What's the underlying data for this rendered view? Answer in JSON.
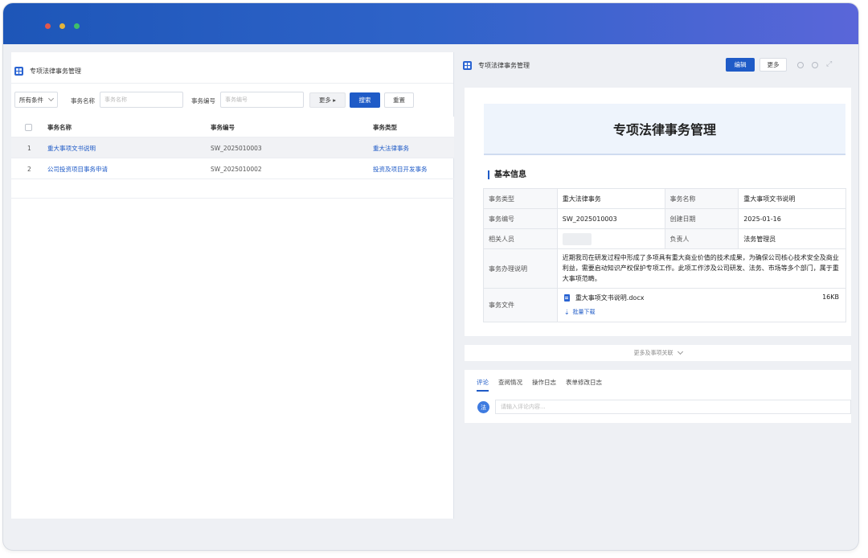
{
  "window": {
    "dots": [
      "red",
      "yellow",
      "green"
    ]
  },
  "left": {
    "title": "专项法律事务管理",
    "filters": {
      "all_conditions": "所有条件",
      "name_label": "事务名称",
      "name_placeholder": "事务名称",
      "code_label": "事务编号",
      "code_placeholder": "事务编号",
      "more": "更多 ▸",
      "search": "搜索",
      "reset": "重置"
    },
    "table": {
      "headers": [
        "事务名称",
        "事务编号",
        "事务类型"
      ],
      "rows": [
        {
          "index": "1",
          "name": "重大事项文书说明",
          "code": "SW_2025010003",
          "type": "重大法律事务"
        },
        {
          "index": "2",
          "name": "公司投资项目事务申请",
          "code": "SW_2025010002",
          "type": "投资及项目开发事务"
        }
      ]
    }
  },
  "right": {
    "title": "专项法律事务管理",
    "edit": "编辑",
    "more": "更多",
    "banner": "专项法律事务管理",
    "section": "基本信息",
    "fields": {
      "type_k": "事务类型",
      "type_v": "重大法律事务",
      "name_k": "事务名称",
      "name_v": "重大事项文书说明",
      "code_k": "事务编号",
      "code_v": "SW_2025010003",
      "date_k": "创建日期",
      "date_v": "2025-01-16",
      "people_k": "相关人员",
      "owner_k": "负责人",
      "owner_v": "法务管理员",
      "desc_k": "事务办理说明",
      "desc_v": "近期我司在研发过程中形成了多项具有重大商业价值的技术成果，为确保公司核心技术安全及商业利益，需要启动知识产权保护专项工作。此项工作涉及公司研发、法务、市场等多个部门，属于重大事项范畴。",
      "file_k": "事务文件",
      "file_name": "重大事项文书说明.docx",
      "file_size": "16KB",
      "batch_download": "批量下载"
    },
    "more_relations": "更多及事项关联",
    "tabs": [
      "评论",
      "查阅情况",
      "操作日志",
      "表单修改日志"
    ],
    "avatar": "法",
    "comment_placeholder": "请输入评论内容..."
  }
}
